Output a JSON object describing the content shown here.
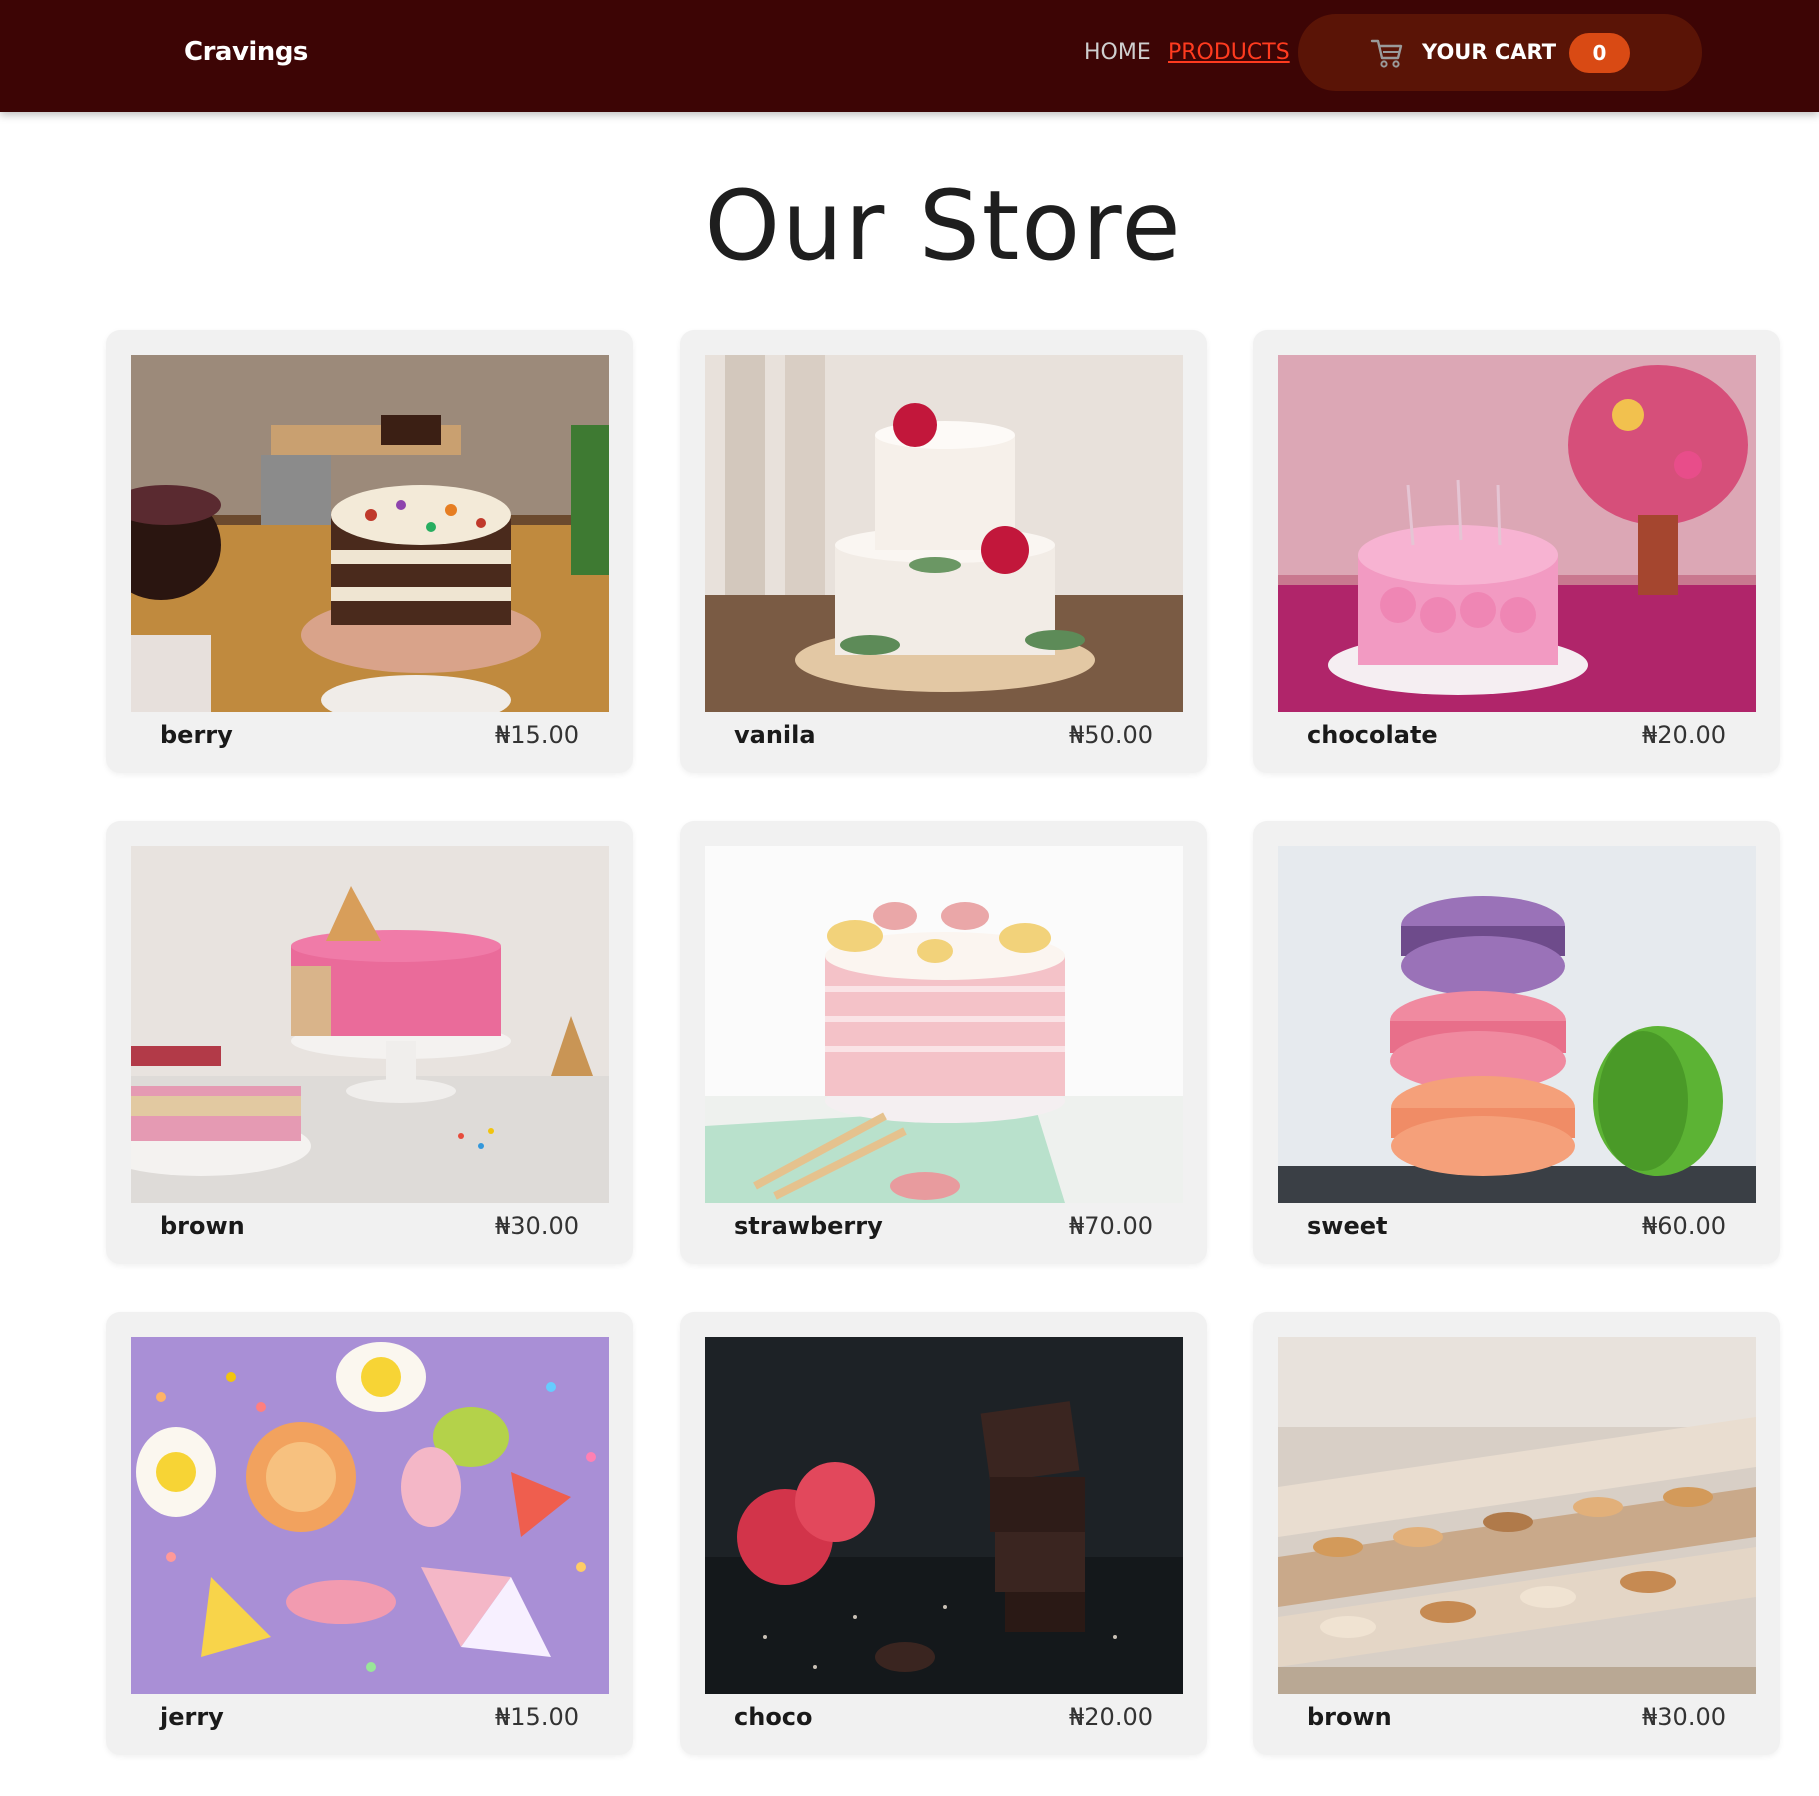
{
  "header": {
    "brand": "Cravings",
    "nav": {
      "home": "HOME",
      "products": "PRODUCTS"
    },
    "cart": {
      "label": "YOUR CART",
      "count": "0"
    },
    "colors": {
      "navbar": "#3d0505",
      "active_link": "#ff3b1f",
      "cart_bg": "#5a1406",
      "badge": "#d94a14"
    }
  },
  "main": {
    "title": "Our Store",
    "products": [
      {
        "name": "berry",
        "price": "₦15.00",
        "image": "layered-cake-on-table"
      },
      {
        "name": "vanila",
        "price": "₦50.00",
        "image": "white-two-tier-cake"
      },
      {
        "name": "chocolate",
        "price": "₦20.00",
        "image": "pink-rose-cake"
      },
      {
        "name": "brown",
        "price": "₦30.00",
        "image": "pink-drip-cake"
      },
      {
        "name": "strawberry",
        "price": "₦70.00",
        "image": "macaron-topped-cake"
      },
      {
        "name": "sweet",
        "price": "₦60.00",
        "image": "macaron-stack"
      },
      {
        "name": "jerry",
        "price": "₦15.00",
        "image": "candy-sprinkles"
      },
      {
        "name": "choco",
        "price": "₦20.00",
        "image": "chocolate-raspberries"
      },
      {
        "name": "brown",
        "price": "₦30.00",
        "image": "pastry-display-case"
      }
    ]
  }
}
